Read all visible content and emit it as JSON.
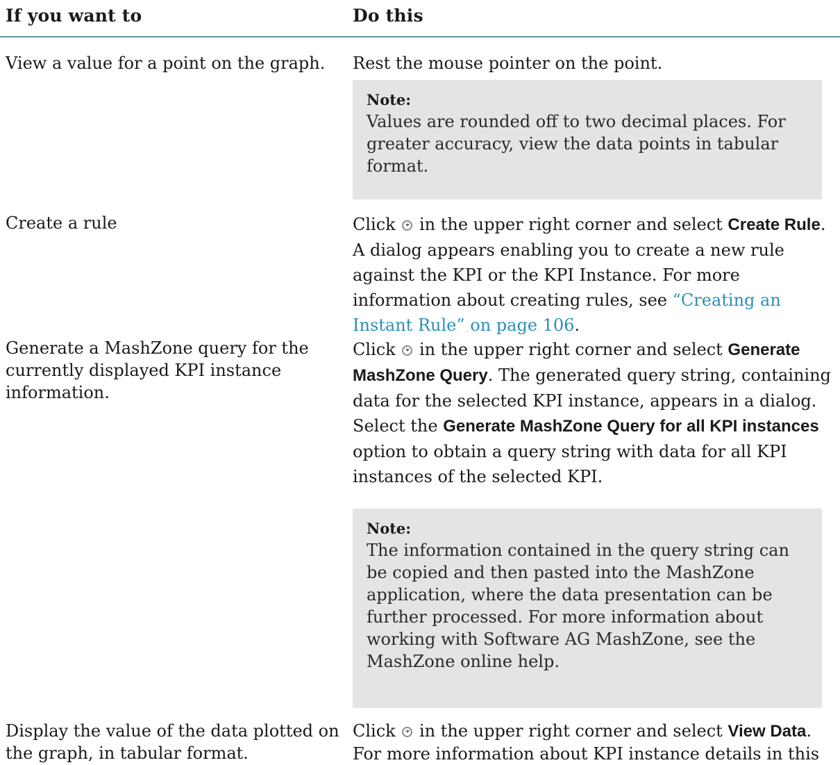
{
  "header": {
    "col_left": "If you want to",
    "col_right": "Do this"
  },
  "rows": [
    {
      "want": "View a value for a point on the graph.",
      "do": "Rest the mouse pointer on the point.",
      "note": {
        "title": "Note:",
        "body": "Values are rounded off to two decimal places. For greater accuracy, view the data points in tabular format."
      }
    },
    {
      "want": "Create a rule",
      "do": {
        "p1": "Click",
        "p2": "in the upper right corner and select",
        "bold1": "Create Rule",
        "p3": ". A dialog appears enabling you to create a new rule against the KPI or the KPI Instance. For more information about creating rules, see",
        "link": "“Creating an Instant Rule” on page 106",
        "p4": "."
      }
    },
    {
      "want": "Generate a MashZone query for the currently displayed KPI instance information.",
      "do": {
        "p1": "Click",
        "p2": "in the upper right corner and select",
        "bold1": "Generate MashZone Query",
        "p3": ". The generated query string, containing data for the selected KPI instance, appears in a dialog. Select the",
        "bold2": "Generate MashZone Query for all KPI instances",
        "p4": "option to obtain a query string with data for all KPI instances of the selected KPI."
      },
      "note": {
        "title": "Note:",
        "body": "The information contained in the query string can be copied and then pasted into the MashZone application, where the data presentation can be further processed. For more information about working with Software AG MashZone, see the MashZone online help."
      }
    },
    {
      "want": "Display the value of the data plotted on the graph, in tabular format.",
      "do": {
        "p1": "Click",
        "p2": "in the upper right corner and select",
        "bold1": "View Data",
        "p3": ". For more information about KPI instance details in this"
      }
    }
  ]
}
